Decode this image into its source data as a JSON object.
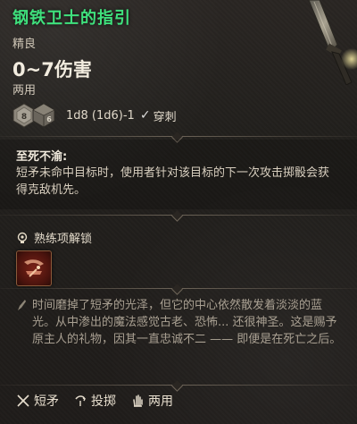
{
  "item": {
    "name": "钢铁卫士的指引",
    "rarity": "精良",
    "damage": "0~7伤害",
    "handedness": "两用",
    "dice_formula": "1d8 (1d6)-1",
    "damage_type": "穿刺",
    "dice": [
      {
        "label": "8",
        "icon": "d8-die-icon"
      },
      {
        "label": "6",
        "icon": "d6-die-icon"
      }
    ]
  },
  "passive": {
    "title": "至死不渝:",
    "description": "短矛未命中目标时，使用者针对该目标的下一次攻击掷骰会获得克敌机先。"
  },
  "proficiency": {
    "label": "熟练项解锁"
  },
  "lore": {
    "text": "时间磨掉了短矛的光泽，但它的中心依然散发着淡淡的蓝光。从中渗出的魔法感觉古老、恐怖... 还很神圣。这是赐予原主人的礼物，因其一直忠诚不二 —— 即便是在死亡之后。"
  },
  "tags": [
    {
      "label": "短矛",
      "icon": "spear-icon"
    },
    {
      "label": "投掷",
      "icon": "throw-icon"
    },
    {
      "label": "两用",
      "icon": "hand-icon"
    }
  ],
  "colors": {
    "title": "#3fe17d",
    "text": "#d9d1c3",
    "lore": "#a9a092",
    "background": "#1f1c19"
  }
}
